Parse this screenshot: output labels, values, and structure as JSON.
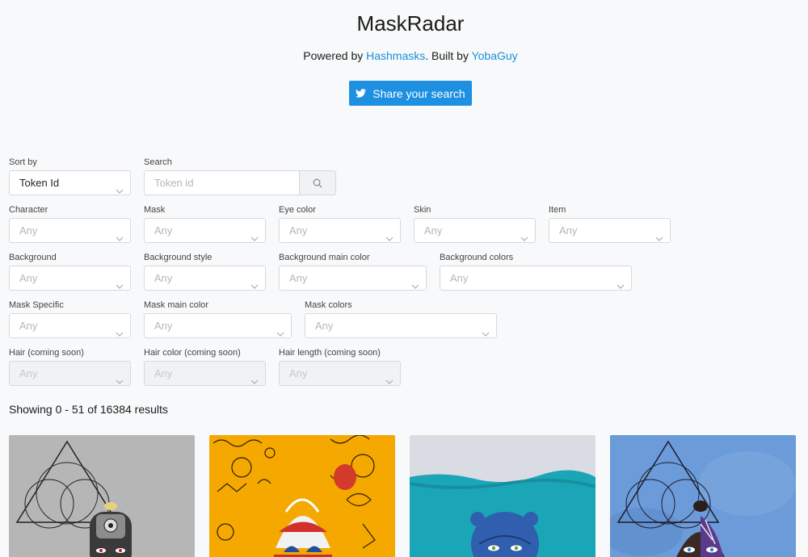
{
  "header": {
    "title": "MaskRadar",
    "powered_prefix": "Powered by ",
    "powered_link": "Hashmasks",
    "built_text": ". Built by ",
    "built_link": "YobaGuy",
    "share_label": "Share your search"
  },
  "filters": {
    "sort_by": {
      "label": "Sort by",
      "value": "Token Id"
    },
    "search": {
      "label": "Search",
      "placeholder": "Token id"
    },
    "character": {
      "label": "Character",
      "value": "Any"
    },
    "mask": {
      "label": "Mask",
      "value": "Any"
    },
    "eye_color": {
      "label": "Eye color",
      "value": "Any"
    },
    "skin": {
      "label": "Skin",
      "value": "Any"
    },
    "item": {
      "label": "Item",
      "value": "Any"
    },
    "background": {
      "label": "Background",
      "value": "Any"
    },
    "background_style": {
      "label": "Background style",
      "value": "Any"
    },
    "background_main_color": {
      "label": "Background main color",
      "value": "Any"
    },
    "background_colors": {
      "label": "Background colors",
      "value": "Any"
    },
    "mask_specific": {
      "label": "Mask Specific",
      "value": "Any"
    },
    "mask_main_color": {
      "label": "Mask main color",
      "value": "Any"
    },
    "mask_colors": {
      "label": "Mask colors",
      "value": "Any"
    },
    "hair": {
      "label": "Hair (coming soon)",
      "value": "Any"
    },
    "hair_color": {
      "label": "Hair color (coming soon)",
      "value": "Any"
    },
    "hair_length": {
      "label": "Hair length (coming soon)",
      "value": "Any"
    }
  },
  "results_text": "Showing 0 - 51 of 16384 results",
  "colors": {
    "accent": "#1e90e2",
    "link": "#1a8fd8",
    "card_backgrounds": [
      "#b9b9b9",
      "#f5a800",
      "#1ba6b8",
      "#6a9ad8"
    ]
  },
  "icons": [
    "twitter-icon",
    "search-icon",
    "chevron-down-icon"
  ]
}
